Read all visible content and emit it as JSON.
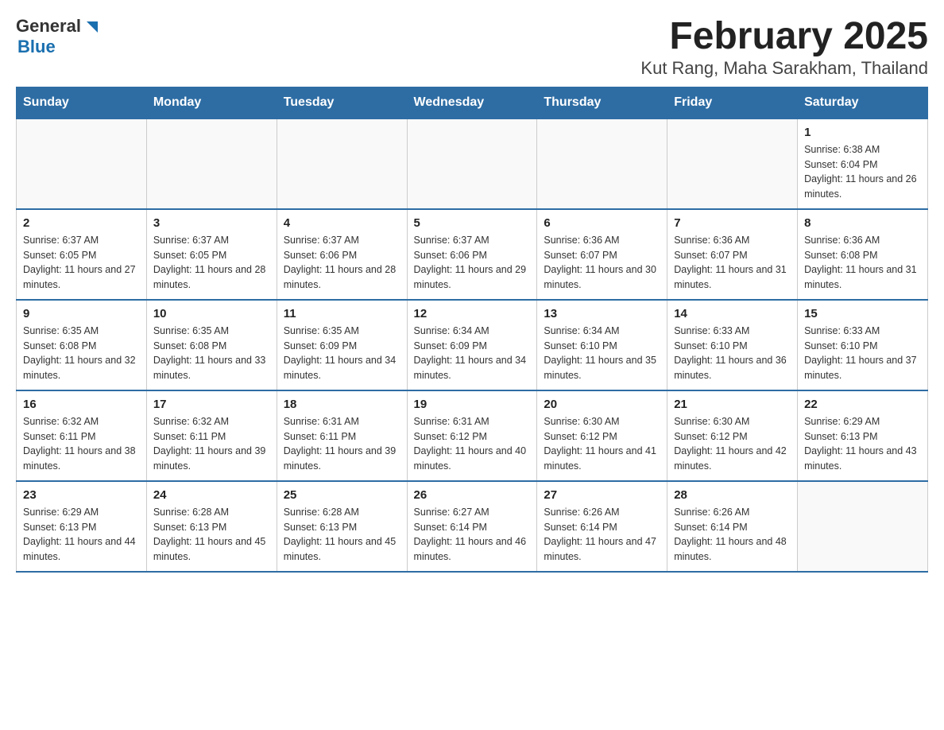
{
  "header": {
    "logo_general": "General",
    "logo_blue": "Blue",
    "title": "February 2025",
    "subtitle": "Kut Rang, Maha Sarakham, Thailand"
  },
  "days_of_week": [
    "Sunday",
    "Monday",
    "Tuesday",
    "Wednesday",
    "Thursday",
    "Friday",
    "Saturday"
  ],
  "weeks": [
    [
      {
        "day": "",
        "info": ""
      },
      {
        "day": "",
        "info": ""
      },
      {
        "day": "",
        "info": ""
      },
      {
        "day": "",
        "info": ""
      },
      {
        "day": "",
        "info": ""
      },
      {
        "day": "",
        "info": ""
      },
      {
        "day": "1",
        "info": "Sunrise: 6:38 AM\nSunset: 6:04 PM\nDaylight: 11 hours and 26 minutes."
      }
    ],
    [
      {
        "day": "2",
        "info": "Sunrise: 6:37 AM\nSunset: 6:05 PM\nDaylight: 11 hours and 27 minutes."
      },
      {
        "day": "3",
        "info": "Sunrise: 6:37 AM\nSunset: 6:05 PM\nDaylight: 11 hours and 28 minutes."
      },
      {
        "day": "4",
        "info": "Sunrise: 6:37 AM\nSunset: 6:06 PM\nDaylight: 11 hours and 28 minutes."
      },
      {
        "day": "5",
        "info": "Sunrise: 6:37 AM\nSunset: 6:06 PM\nDaylight: 11 hours and 29 minutes."
      },
      {
        "day": "6",
        "info": "Sunrise: 6:36 AM\nSunset: 6:07 PM\nDaylight: 11 hours and 30 minutes."
      },
      {
        "day": "7",
        "info": "Sunrise: 6:36 AM\nSunset: 6:07 PM\nDaylight: 11 hours and 31 minutes."
      },
      {
        "day": "8",
        "info": "Sunrise: 6:36 AM\nSunset: 6:08 PM\nDaylight: 11 hours and 31 minutes."
      }
    ],
    [
      {
        "day": "9",
        "info": "Sunrise: 6:35 AM\nSunset: 6:08 PM\nDaylight: 11 hours and 32 minutes."
      },
      {
        "day": "10",
        "info": "Sunrise: 6:35 AM\nSunset: 6:08 PM\nDaylight: 11 hours and 33 minutes."
      },
      {
        "day": "11",
        "info": "Sunrise: 6:35 AM\nSunset: 6:09 PM\nDaylight: 11 hours and 34 minutes."
      },
      {
        "day": "12",
        "info": "Sunrise: 6:34 AM\nSunset: 6:09 PM\nDaylight: 11 hours and 34 minutes."
      },
      {
        "day": "13",
        "info": "Sunrise: 6:34 AM\nSunset: 6:10 PM\nDaylight: 11 hours and 35 minutes."
      },
      {
        "day": "14",
        "info": "Sunrise: 6:33 AM\nSunset: 6:10 PM\nDaylight: 11 hours and 36 minutes."
      },
      {
        "day": "15",
        "info": "Sunrise: 6:33 AM\nSunset: 6:10 PM\nDaylight: 11 hours and 37 minutes."
      }
    ],
    [
      {
        "day": "16",
        "info": "Sunrise: 6:32 AM\nSunset: 6:11 PM\nDaylight: 11 hours and 38 minutes."
      },
      {
        "day": "17",
        "info": "Sunrise: 6:32 AM\nSunset: 6:11 PM\nDaylight: 11 hours and 39 minutes."
      },
      {
        "day": "18",
        "info": "Sunrise: 6:31 AM\nSunset: 6:11 PM\nDaylight: 11 hours and 39 minutes."
      },
      {
        "day": "19",
        "info": "Sunrise: 6:31 AM\nSunset: 6:12 PM\nDaylight: 11 hours and 40 minutes."
      },
      {
        "day": "20",
        "info": "Sunrise: 6:30 AM\nSunset: 6:12 PM\nDaylight: 11 hours and 41 minutes."
      },
      {
        "day": "21",
        "info": "Sunrise: 6:30 AM\nSunset: 6:12 PM\nDaylight: 11 hours and 42 minutes."
      },
      {
        "day": "22",
        "info": "Sunrise: 6:29 AM\nSunset: 6:13 PM\nDaylight: 11 hours and 43 minutes."
      }
    ],
    [
      {
        "day": "23",
        "info": "Sunrise: 6:29 AM\nSunset: 6:13 PM\nDaylight: 11 hours and 44 minutes."
      },
      {
        "day": "24",
        "info": "Sunrise: 6:28 AM\nSunset: 6:13 PM\nDaylight: 11 hours and 45 minutes."
      },
      {
        "day": "25",
        "info": "Sunrise: 6:28 AM\nSunset: 6:13 PM\nDaylight: 11 hours and 45 minutes."
      },
      {
        "day": "26",
        "info": "Sunrise: 6:27 AM\nSunset: 6:14 PM\nDaylight: 11 hours and 46 minutes."
      },
      {
        "day": "27",
        "info": "Sunrise: 6:26 AM\nSunset: 6:14 PM\nDaylight: 11 hours and 47 minutes."
      },
      {
        "day": "28",
        "info": "Sunrise: 6:26 AM\nSunset: 6:14 PM\nDaylight: 11 hours and 48 minutes."
      },
      {
        "day": "",
        "info": ""
      }
    ]
  ]
}
